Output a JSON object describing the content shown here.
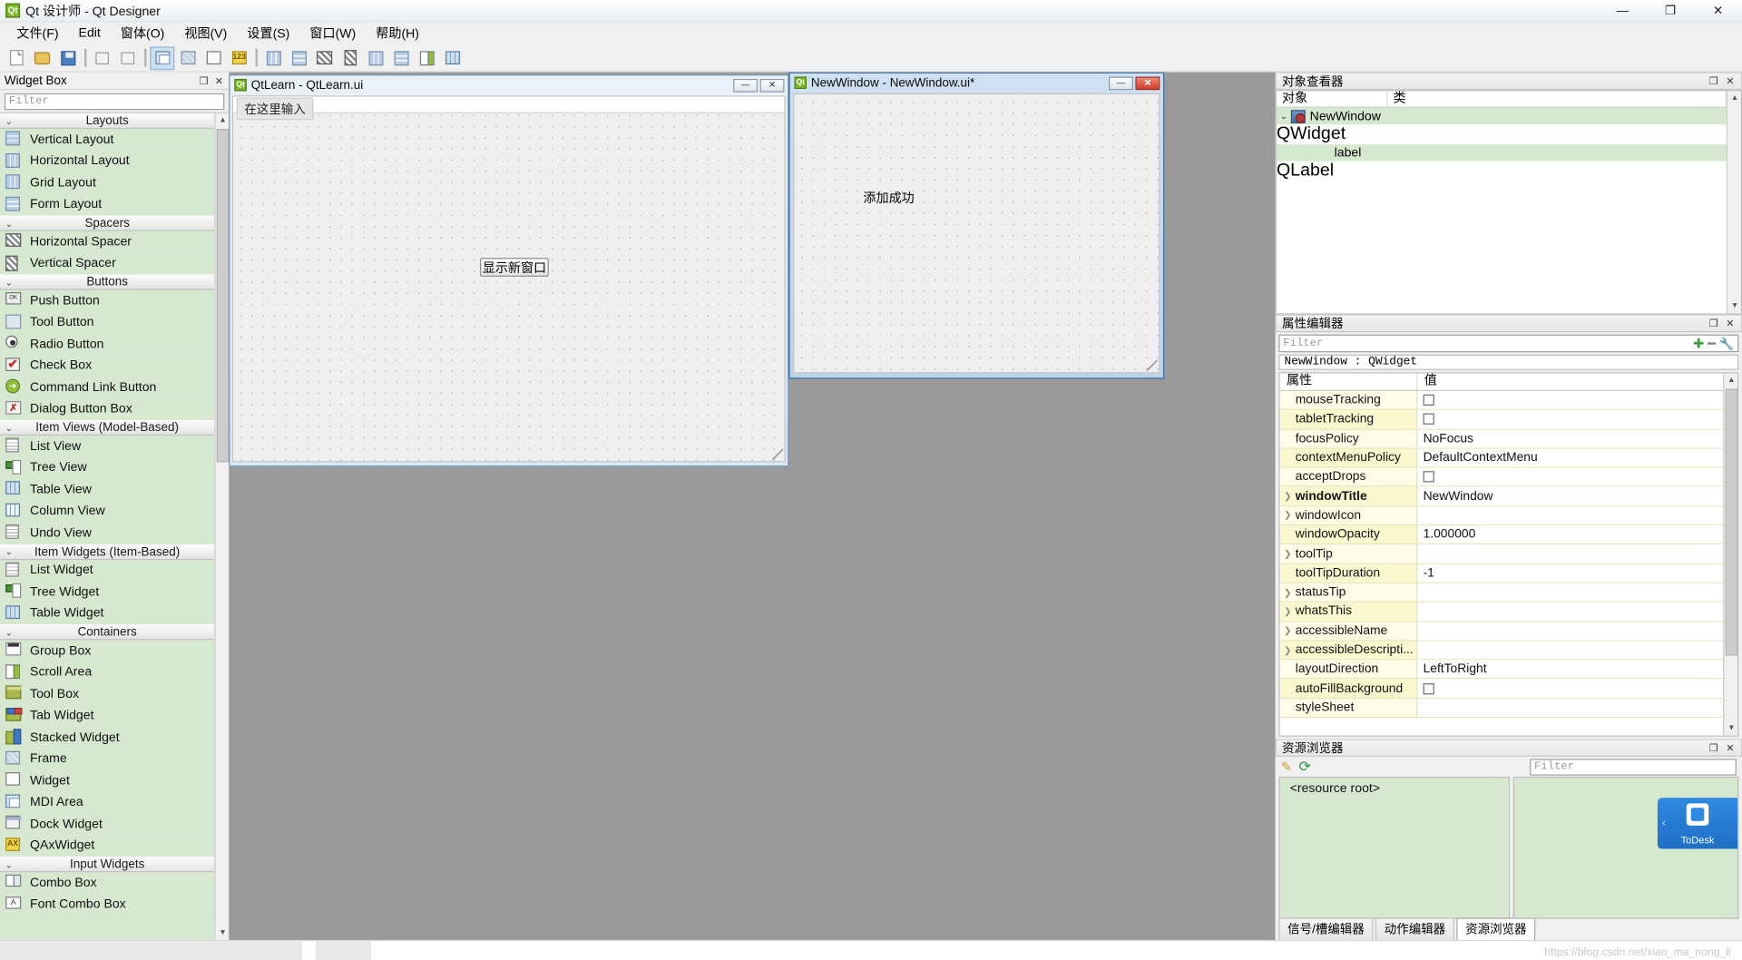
{
  "titlebar": {
    "app_icon": "Qt",
    "title": "Qt 设计师 - Qt Designer",
    "minimize": "—",
    "maximize": "❐",
    "close": "✕"
  },
  "menubar": {
    "items": [
      {
        "label": "文件(F)"
      },
      {
        "label": "Edit"
      },
      {
        "label": "窗体(O)"
      },
      {
        "label": "视图(V)"
      },
      {
        "label": "设置(S)"
      },
      {
        "label": "窗口(W)"
      },
      {
        "label": "帮助(H)"
      }
    ]
  },
  "toolbar": {
    "buttons": [
      {
        "name": "new-form-button",
        "icon": "document-icon"
      },
      {
        "name": "open-form-button",
        "icon": "folder-open-icon"
      },
      {
        "name": "save-form-button",
        "icon": "floppy-save-icon"
      },
      {
        "name": "undo-button",
        "icon": "undo-icon"
      },
      {
        "name": "redo-button",
        "icon": "redo-icon"
      },
      {
        "name": "edit-widgets-button",
        "icon": "edit-widgets-icon"
      },
      {
        "name": "edit-signals-slots-button",
        "icon": "signals-slots-icon"
      },
      {
        "name": "edit-buddies-button",
        "icon": "buddies-icon"
      },
      {
        "name": "edit-tab-order-button",
        "icon": "tab-order-icon"
      },
      {
        "name": "layout-horizontally-button",
        "icon": "layout-horizontal-icon"
      },
      {
        "name": "layout-vertically-button",
        "icon": "layout-vertical-icon"
      },
      {
        "name": "layout-splitter-horizontal-button",
        "icon": "splitter-horizontal-icon"
      },
      {
        "name": "layout-splitter-vertical-button",
        "icon": "splitter-vertical-icon"
      },
      {
        "name": "layout-grid-button",
        "icon": "layout-grid-icon"
      },
      {
        "name": "layout-form-button",
        "icon": "layout-form-icon"
      },
      {
        "name": "break-layout-button",
        "icon": "break-layout-icon"
      },
      {
        "name": "adjust-size-button",
        "icon": "adjust-size-icon"
      }
    ]
  },
  "widget_box": {
    "title": "Widget Box",
    "filter_placeholder": "Filter",
    "undock_glyph": "❐",
    "close_glyph": "✕",
    "groups": [
      {
        "name": "Layouts",
        "chevron": "⌄",
        "items": [
          {
            "label": "Vertical Layout",
            "icon": "vertical-layout-icon",
            "cls": "ic-vl"
          },
          {
            "label": "Horizontal Layout",
            "icon": "horizontal-layout-icon",
            "cls": "ic-hl"
          },
          {
            "label": "Grid Layout",
            "icon": "grid-layout-icon",
            "cls": "ic-grid"
          },
          {
            "label": "Form Layout",
            "icon": "form-layout-icon",
            "cls": "ic-form"
          }
        ]
      },
      {
        "name": "Spacers",
        "chevron": "⌄",
        "items": [
          {
            "label": "Horizontal Spacer",
            "icon": "horizontal-spacer-icon",
            "cls": "ic-hsp"
          },
          {
            "label": "Vertical Spacer",
            "icon": "vertical-spacer-icon",
            "cls": "ic-vsp"
          }
        ]
      },
      {
        "name": "Buttons",
        "chevron": "⌄",
        "items": [
          {
            "label": "Push Button",
            "icon": "push-button-icon",
            "cls": "ic-push",
            "glyph": "OK"
          },
          {
            "label": "Tool Button",
            "icon": "tool-button-icon",
            "cls": "ic-tool"
          },
          {
            "label": "Radio Button",
            "icon": "radio-button-icon",
            "cls": "ic-radio"
          },
          {
            "label": "Check Box",
            "icon": "check-box-icon",
            "cls": "ic-check",
            "glyph": "✔"
          },
          {
            "label": "Command Link Button",
            "icon": "command-link-button-icon",
            "cls": "ic-cmd",
            "glyph": "➜"
          },
          {
            "label": "Dialog Button Box",
            "icon": "dialog-button-box-icon",
            "cls": "ic-dlg",
            "glyph": "✗"
          }
        ]
      },
      {
        "name": "Item Views (Model-Based)",
        "chevron": "⌄",
        "items": [
          {
            "label": "List View",
            "icon": "list-view-icon",
            "cls": "ic-list"
          },
          {
            "label": "Tree View",
            "icon": "tree-view-icon",
            "cls": "ic-tree"
          },
          {
            "label": "Table View",
            "icon": "table-view-icon",
            "cls": "ic-table"
          },
          {
            "label": "Column View",
            "icon": "column-view-icon",
            "cls": "ic-col"
          },
          {
            "label": "Undo View",
            "icon": "undo-view-icon",
            "cls": "ic-list"
          }
        ]
      },
      {
        "name": "Item Widgets (Item-Based)",
        "chevron": "⌄",
        "items": [
          {
            "label": "List Widget",
            "icon": "list-widget-icon",
            "cls": "ic-list"
          },
          {
            "label": "Tree Widget",
            "icon": "tree-widget-icon",
            "cls": "ic-tree"
          },
          {
            "label": "Table Widget",
            "icon": "table-widget-icon",
            "cls": "ic-table"
          }
        ]
      },
      {
        "name": "Containers",
        "chevron": "⌄",
        "items": [
          {
            "label": "Group Box",
            "icon": "group-box-icon",
            "cls": "ic-group"
          },
          {
            "label": "Scroll Area",
            "icon": "scroll-area-icon",
            "cls": "ic-scroll"
          },
          {
            "label": "Tool Box",
            "icon": "tool-box-icon",
            "cls": "ic-toolbox"
          },
          {
            "label": "Tab Widget",
            "icon": "tab-widget-icon",
            "cls": "ic-tab"
          },
          {
            "label": "Stacked Widget",
            "icon": "stacked-widget-icon",
            "cls": "ic-stack"
          },
          {
            "label": "Frame",
            "icon": "frame-icon",
            "cls": "ic-frame"
          },
          {
            "label": "Widget",
            "icon": "widget-icon",
            "cls": "ic-widget"
          },
          {
            "label": "MDI Area",
            "icon": "mdi-area-icon",
            "cls": "ic-mdi"
          },
          {
            "label": "Dock Widget",
            "icon": "dock-widget-icon",
            "cls": "ic-dock"
          },
          {
            "label": "QAxWidget",
            "icon": "qax-widget-icon",
            "cls": "ic-ax",
            "glyph": "AX"
          }
        ]
      },
      {
        "name": "Input Widgets",
        "chevron": "⌄",
        "items": [
          {
            "label": "Combo Box",
            "icon": "combo-box-icon",
            "cls": "ic-combo"
          },
          {
            "label": "Font Combo Box",
            "icon": "font-combo-box-icon",
            "cls": "ic-fontcombo",
            "glyph": "A"
          }
        ]
      }
    ]
  },
  "forms": {
    "qtlearn": {
      "icon": "Qt",
      "title": "QtLearn - QtLearn.ui",
      "minimize": "—",
      "close": "✕",
      "menu_placeholder": "在这里输入",
      "button_label": "显示新窗口"
    },
    "newwindow": {
      "icon": "Qt",
      "title": "NewWindow - NewWindow.ui*",
      "minimize": "—",
      "close": "✕",
      "label_text": "添加成功"
    }
  },
  "object_inspector": {
    "title": "对象查看器",
    "undock_glyph": "❐",
    "close_glyph": "✕",
    "columns": [
      "对象",
      "类"
    ],
    "rows": [
      {
        "chevron": "⌄",
        "name": "NewWindow",
        "class": "QWidget",
        "level": 0,
        "icon": "widget-icon",
        "selected": true
      },
      {
        "chevron": "",
        "name": "label",
        "class": "QLabel",
        "level": 1,
        "icon": "",
        "selected": false
      }
    ]
  },
  "property_editor": {
    "title": "属性编辑器",
    "undock_glyph": "❐",
    "close_glyph": "✕",
    "filter_placeholder": "Filter",
    "object_line": "NewWindow : QWidget",
    "columns": [
      "属性",
      "值"
    ],
    "add_glyph": "✚",
    "remove_glyph": "━",
    "configure_glyph": "🔧",
    "rows": [
      {
        "name": "mouseTracking",
        "value": "",
        "type": "checkbox",
        "expandable": false,
        "bold": false
      },
      {
        "name": "tabletTracking",
        "value": "",
        "type": "checkbox",
        "expandable": false,
        "bold": false
      },
      {
        "name": "focusPolicy",
        "value": "NoFocus",
        "type": "text",
        "expandable": false,
        "bold": false
      },
      {
        "name": "contextMenuPolicy",
        "value": "DefaultContextMenu",
        "type": "text",
        "expandable": false,
        "bold": false
      },
      {
        "name": "acceptDrops",
        "value": "",
        "type": "checkbox",
        "expandable": false,
        "bold": false
      },
      {
        "name": "windowTitle",
        "value": "NewWindow",
        "type": "text",
        "expandable": true,
        "bold": true
      },
      {
        "name": "windowIcon",
        "value": "",
        "type": "text",
        "expandable": true,
        "bold": false
      },
      {
        "name": "windowOpacity",
        "value": "1.000000",
        "type": "text",
        "expandable": false,
        "bold": false
      },
      {
        "name": "toolTip",
        "value": "",
        "type": "text",
        "expandable": true,
        "bold": false
      },
      {
        "name": "toolTipDuration",
        "value": "-1",
        "type": "text",
        "expandable": false,
        "bold": false
      },
      {
        "name": "statusTip",
        "value": "",
        "type": "text",
        "expandable": true,
        "bold": false
      },
      {
        "name": "whatsThis",
        "value": "",
        "type": "text",
        "expandable": true,
        "bold": false
      },
      {
        "name": "accessibleName",
        "value": "",
        "type": "text",
        "expandable": true,
        "bold": false
      },
      {
        "name": "accessibleDescripti...",
        "value": "",
        "type": "text",
        "expandable": true,
        "bold": false
      },
      {
        "name": "layoutDirection",
        "value": "LeftToRight",
        "type": "text",
        "expandable": false,
        "bold": false
      },
      {
        "name": "autoFillBackground",
        "value": "",
        "type": "checkbox",
        "expandable": false,
        "bold": false
      },
      {
        "name": "styleSheet",
        "value": "",
        "type": "text",
        "expandable": false,
        "bold": false
      }
    ]
  },
  "resource_browser": {
    "title": "资源浏览器",
    "undock_glyph": "❐",
    "close_glyph": "✕",
    "edit_glyph": "✎",
    "reload_glyph": "⟳",
    "filter_placeholder": "Filter",
    "root_label": "<resource root>"
  },
  "bottom_tabs": {
    "tabs": [
      {
        "label": "信号/槽编辑器",
        "active": false
      },
      {
        "label": "动作编辑器",
        "active": false
      },
      {
        "label": "资源浏览器",
        "active": true
      }
    ]
  },
  "todesk": {
    "arrow": "‹",
    "label": "ToDesk"
  },
  "watermark": {
    "text": "https://blog.csdn.net/xiao_ma_nong_li"
  }
}
